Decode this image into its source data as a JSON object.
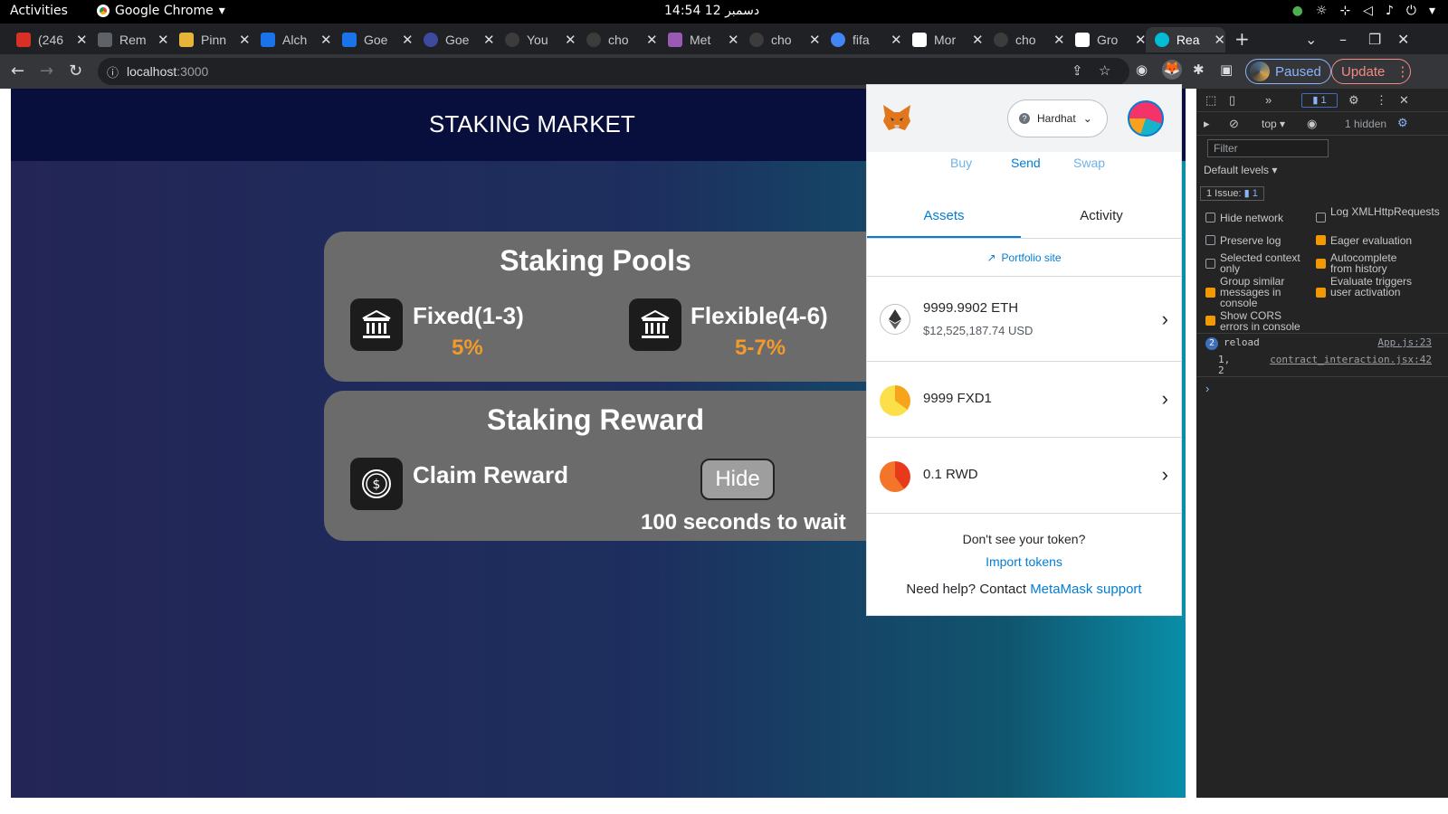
{
  "system_bar": {
    "activities": "Activities",
    "app_name": "Google Chrome",
    "clock": "14:54  12 دسمبر"
  },
  "tabs": [
    {
      "title": "(246",
      "color": "#d93025"
    },
    {
      "title": "Rem",
      "color": "#5f6368"
    },
    {
      "title": "Pinn",
      "color": "#e8b339"
    },
    {
      "title": "Alch",
      "color": "#1a73e8"
    },
    {
      "title": "Goe",
      "color": "#1a73e8"
    },
    {
      "title": "Goe",
      "color": "#3c4b9e"
    },
    {
      "title": "You",
      "color": "#3c3c3c"
    },
    {
      "title": "cho",
      "color": "#3c3c3c"
    },
    {
      "title": "Met",
      "color": "#9b59b6"
    },
    {
      "title": "cho",
      "color": "#3c3c3c"
    },
    {
      "title": "fifa",
      "color": "#4285f4"
    },
    {
      "title": "Mor",
      "color": "#ffffff"
    },
    {
      "title": "cho",
      "color": "#3c3c3c"
    },
    {
      "title": "Gro",
      "color": "#ffffff"
    },
    {
      "title": "Rea",
      "color": "#00bcd4"
    }
  ],
  "address_bar": {
    "host": "localhost",
    "port": ":3000"
  },
  "profile": {
    "paused_label": "Paused",
    "update_label": "Update"
  },
  "dapp": {
    "header_title": "STAKING MARKET",
    "pools_title": "Staking Pools",
    "fixed_label": "Fixed(1-3)",
    "fixed_rate": "5%",
    "flexible_label": "Flexible(4-6)",
    "flexible_rate": "5-7%",
    "reward_title": "Staking Reward",
    "claim_label": "Claim Reward",
    "hide_button": "Hide",
    "wait_text": "100 seconds to wait"
  },
  "metamask": {
    "network": "Hardhat",
    "actions": {
      "buy": "Buy",
      "send": "Send",
      "swap": "Swap"
    },
    "tabs": {
      "assets": "Assets",
      "activity": "Activity"
    },
    "portfolio_link": "Portfolio site",
    "assets": [
      {
        "amount": "9999.9902 ETH",
        "usd": "$12,525,187.74 USD"
      },
      {
        "amount": "9999 FXD1",
        "usd": ""
      },
      {
        "amount": "0.1 RWD",
        "usd": ""
      }
    ],
    "no_token_text": "Don't see your token?",
    "import_tokens": "Import tokens",
    "help_text": "Need help? Contact ",
    "support_link": "MetaMask support"
  },
  "devtools": {
    "context": "top",
    "hidden_count": "1 hidden",
    "filter_placeholder": "Filter",
    "levels": "Default levels",
    "issues_label": "1 Issue:",
    "issues_count": "1",
    "messages_badge": "1",
    "options": [
      {
        "label": "Hide network",
        "checked": false
      },
      {
        "label": "Log XMLHttpRequests",
        "checked": false
      },
      {
        "label": "Preserve log",
        "checked": false
      },
      {
        "label": "Eager evaluation",
        "checked": true
      },
      {
        "label": "Selected context only",
        "checked": false
      },
      {
        "label": "Autocomplete from history",
        "checked": true
      },
      {
        "label": "Group similar messages in console",
        "checked": true
      },
      {
        "label": "Evaluate triggers user activation",
        "checked": true
      },
      {
        "label": "Show CORS errors in console",
        "checked": true
      }
    ],
    "console": [
      {
        "count": "2",
        "text": "reload",
        "source": "App.js:23"
      },
      {
        "count": "",
        "text": "1,",
        "source": "contract_interaction.jsx:42"
      },
      {
        "count": "",
        "text": "2",
        "source": ""
      }
    ]
  }
}
